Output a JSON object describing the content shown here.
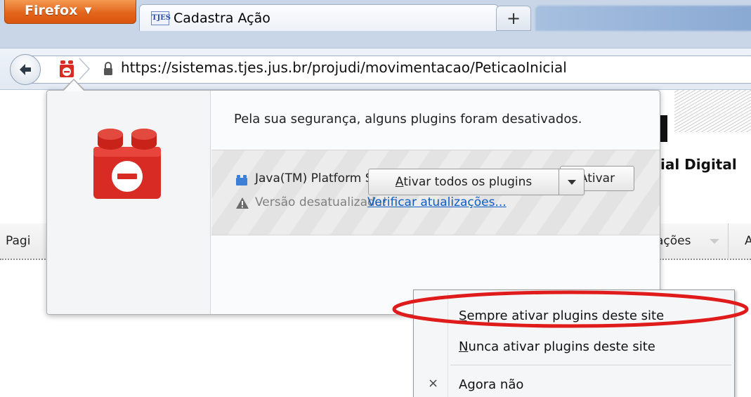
{
  "browser": {
    "app_button_label": "Firefox",
    "tab": {
      "favicon_text": "TJES",
      "title": "Cadastra Ação"
    },
    "new_tab_label": "+"
  },
  "navbar": {
    "url": "https://sistemas.tjes.jus.br/projudi/movimentacao/PeticaoInicial"
  },
  "page": {
    "subtitle": "ial Digital",
    "menu": {
      "item_left": "Pagi",
      "item_acoes": "ações",
      "item_right": "A"
    }
  },
  "doorhanger": {
    "message": "Pela sua segurança, alguns plugins foram desativados.",
    "plugin": {
      "name": "Java(TM) Platform SE 7 U",
      "activate_label": "Ativar",
      "warning_text": "Versão desatualizada!",
      "update_link": "Verificar atualizações..."
    },
    "activate_all": {
      "accesskey": "A",
      "rest": "tivar todos os plugins"
    }
  },
  "menu": {
    "items": [
      {
        "accesskey": "S",
        "rest": "empre ativar plugins deste site"
      },
      {
        "accesskey": "N",
        "rest": "unca ativar plugins deste site"
      },
      {
        "label": "Agora não",
        "mark": "×"
      }
    ]
  },
  "colors": {
    "tabstrip": "#c9d6e7",
    "firefox_button": "#e3641b",
    "lego_red": "#d72b23",
    "link": "#0b5dc7",
    "highlight": "#e01b1b"
  },
  "icons": {
    "back": "back-arrow-icon",
    "plugin": "plugin-lego-icon",
    "lock": "lock-icon",
    "warning": "warning-icon",
    "java": "java-plugin-icon"
  }
}
